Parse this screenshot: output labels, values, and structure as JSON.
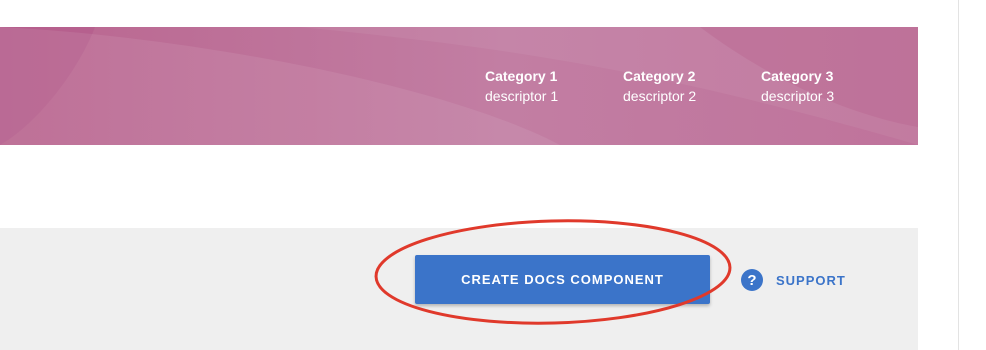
{
  "header": {
    "categories": [
      {
        "title": "Category 1",
        "descriptor": "descriptor 1"
      },
      {
        "title": "Category 2",
        "descriptor": "descriptor 2"
      },
      {
        "title": "Category 3",
        "descriptor": "descriptor 3"
      }
    ]
  },
  "toolbar": {
    "create_label": "CREATE DOCS COMPONENT",
    "support_label": "SUPPORT",
    "support_icon_glyph": "?"
  },
  "colors": {
    "banner": "#bf739b",
    "button": "#3b74c9",
    "annotation": "#e0392b",
    "toolbar_bg": "#efefef"
  },
  "icons": {
    "support": "help-circle-icon"
  }
}
